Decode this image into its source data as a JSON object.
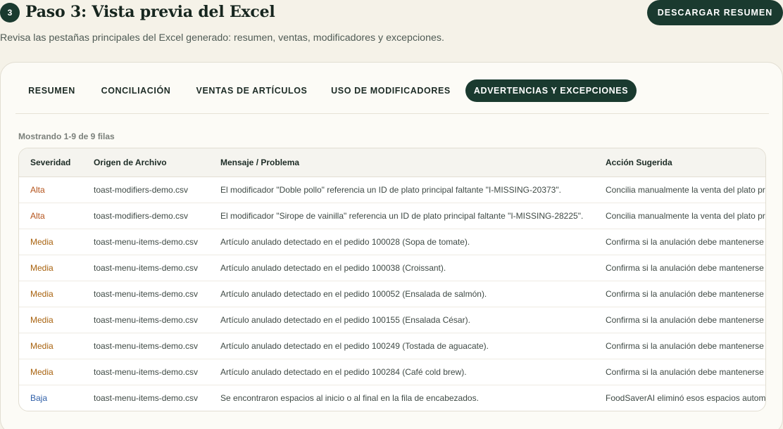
{
  "header": {
    "step_number": "3",
    "title": "Paso 3: Vista previa del Excel",
    "download_label": "DESCARGAR RESUMEN",
    "subtitle": "Revisa las pestañas principales del Excel generado: resumen, ventas, modificadores y excepciones."
  },
  "tabs": [
    {
      "label": "RESUMEN",
      "active": false
    },
    {
      "label": "CONCILIACIÓN",
      "active": false
    },
    {
      "label": "VENTAS DE ARTÍCULOS",
      "active": false
    },
    {
      "label": "USO DE MODIFICADORES",
      "active": false
    },
    {
      "label": "ADVERTENCIAS Y EXCEPCIONES",
      "active": true
    }
  ],
  "table": {
    "count_text": "Mostrando 1-9 de 9 filas",
    "columns": [
      "Severidad",
      "Origen de Archivo",
      "Mensaje / Problema",
      "Acción Sugerida"
    ],
    "rows": [
      {
        "severity": "Alta",
        "level": "alta",
        "source": "toast-modifiers-demo.csv",
        "message": "El modificador \"Doble pollo\" referencia un ID de plato principal faltante \"I-MISSING-20373\".",
        "action": "Concilia manualmente la venta del plato principal"
      },
      {
        "severity": "Alta",
        "level": "alta",
        "source": "toast-modifiers-demo.csv",
        "message": "El modificador \"Sirope de vainilla\" referencia un ID de plato principal faltante \"I-MISSING-28225\".",
        "action": "Concilia manualmente la venta del plato principal"
      },
      {
        "severity": "Media",
        "level": "media",
        "source": "toast-menu-items-demo.csv",
        "message": "Artículo anulado detectado en el pedido 100028 (Sopa de tomate).",
        "action": "Confirma si la anulación debe mantenerse"
      },
      {
        "severity": "Media",
        "level": "media",
        "source": "toast-menu-items-demo.csv",
        "message": "Artículo anulado detectado en el pedido 100038 (Croissant).",
        "action": "Confirma si la anulación debe mantenerse"
      },
      {
        "severity": "Media",
        "level": "media",
        "source": "toast-menu-items-demo.csv",
        "message": "Artículo anulado detectado en el pedido 100052 (Ensalada de salmón).",
        "action": "Confirma si la anulación debe mantenerse"
      },
      {
        "severity": "Media",
        "level": "media",
        "source": "toast-menu-items-demo.csv",
        "message": "Artículo anulado detectado en el pedido 100155 (Ensalada César).",
        "action": "Confirma si la anulación debe mantenerse"
      },
      {
        "severity": "Media",
        "level": "media",
        "source": "toast-menu-items-demo.csv",
        "message": "Artículo anulado detectado en el pedido 100249 (Tostada de aguacate).",
        "action": "Confirma si la anulación debe mantenerse"
      },
      {
        "severity": "Media",
        "level": "media",
        "source": "toast-menu-items-demo.csv",
        "message": "Artículo anulado detectado en el pedido 100284 (Café cold brew).",
        "action": "Confirma si la anulación debe mantenerse"
      },
      {
        "severity": "Baja",
        "level": "baja",
        "source": "toast-menu-items-demo.csv",
        "message": "Se encontraron espacios al inicio o al final en la fila de encabezados.",
        "action": "FoodSaverAI eliminó esos espacios automáticamente"
      }
    ]
  },
  "colors": {
    "accent": "#1a3a2f",
    "background": "#f5f2e8",
    "severity_alta": "#b4531c",
    "severity_media": "#a8620e",
    "severity_baja": "#2f5fa8"
  }
}
